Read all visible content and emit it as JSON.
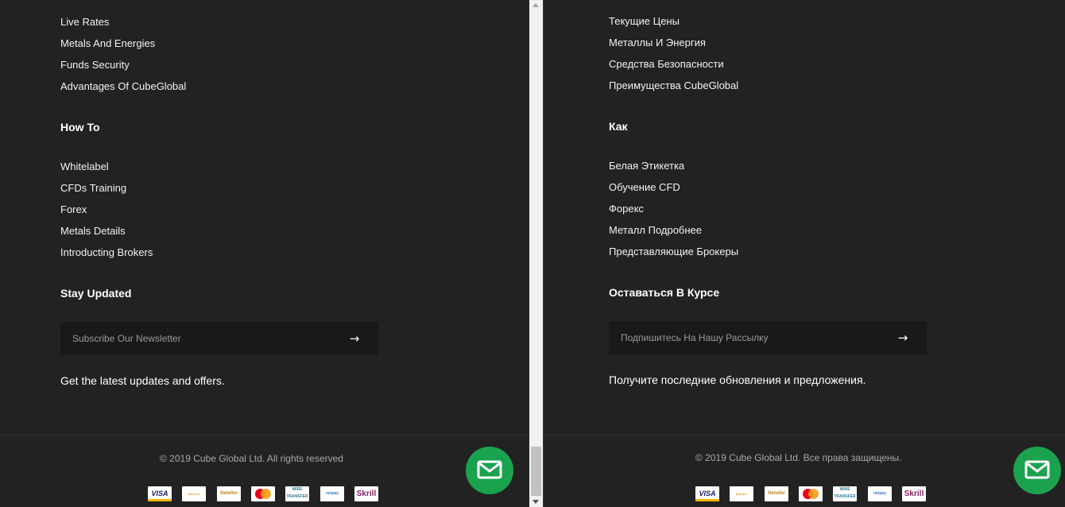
{
  "en": {
    "links_top": [
      "Live Rates",
      "Metals And Energies",
      "Funds Security",
      "Advantages Of CubeGlobal"
    ],
    "howto_heading": "How To",
    "howto_links": [
      "Whitelabel",
      "CFDs Training",
      "Forex",
      "Metals Details",
      "Introducting Brokers"
    ],
    "updates_heading": "Stay Updated",
    "newsletter_placeholder": "Subscribe Our Newsletter",
    "submit_arrow": "→",
    "tagline": "Get the latest updates and offers.",
    "copyright": "© 2019 Cube Global Ltd. All rights reserved"
  },
  "ru": {
    "links_top": [
      "Текущие Цены",
      "Металлы И Энергия",
      "Средства Безопасности",
      "Преимущества CubeGlobal"
    ],
    "howto_heading": "Как",
    "howto_links": [
      "Белая Этикетка",
      "Обучение CFD",
      "Форекс",
      "Металл Подробнее",
      "Представляющие Брокеры"
    ],
    "updates_heading": "Оставаться В Курсе",
    "newsletter_placeholder": "Подпишитесь На Нашу Рассылку",
    "submit_arrow": "→",
    "tagline": "Получите последние обновления и предложения.",
    "copyright": "© 2019 Cube Global Ltd. Все права защищены."
  },
  "payment_logos": {
    "visa": "VISA",
    "bitcoin": "bitcoin",
    "neteller": "Neteller",
    "wire": "WIRE TRANSFER",
    "netpay": "netpay",
    "skrill": "Skrill"
  },
  "icons": {
    "mail": "mail-icon",
    "submit": "arrow-right-icon"
  },
  "colors": {
    "background": "#222222",
    "fab": "#1aa24f",
    "text": "#ffffff"
  }
}
